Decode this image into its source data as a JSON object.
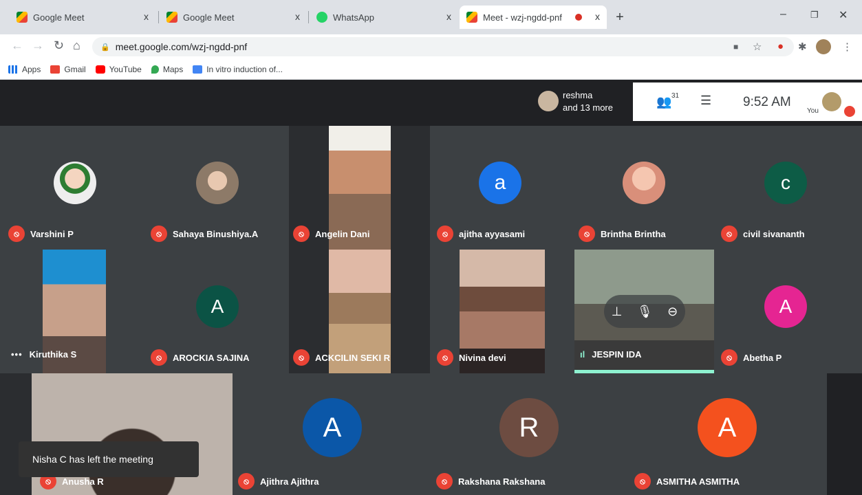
{
  "browser": {
    "tabs": [
      {
        "title": "Google Meet",
        "close": "x"
      },
      {
        "title": "Google Meet",
        "close": "x"
      },
      {
        "title": "WhatsApp",
        "close": "x"
      },
      {
        "title": "Meet - wzj-ngdd-pnf",
        "close": "x"
      }
    ],
    "new_tab": "+",
    "url": "meet.google.com/wzj-ngdd-pnf",
    "bookmarks": [
      "Apps",
      "Gmail",
      "YouTube",
      "Maps",
      "In vitro induction of..."
    ]
  },
  "meet": {
    "presenter": {
      "name": "reshma",
      "more": "and 13 more"
    },
    "participant_count": "31",
    "time": "9:52 AM",
    "self_label": "You",
    "toast": "Nisha C has left the meeting",
    "tiles": [
      {
        "name": "Varshini P",
        "kind": "photo",
        "muted": true
      },
      {
        "name": "Sahaya Binushiya.A",
        "kind": "photo",
        "muted": true
      },
      {
        "name": "Angelin Dani",
        "kind": "video",
        "muted": true
      },
      {
        "name": "ajitha ayyasami",
        "kind": "letter",
        "letter": "a",
        "color": "#1a73e8",
        "muted": true
      },
      {
        "name": "Brintha Brintha",
        "kind": "photo",
        "muted": true
      },
      {
        "name": "civil sivananth",
        "kind": "letter",
        "letter": "c",
        "color": "#0d5c46",
        "muted": true
      },
      {
        "name": "Kiruthika S",
        "kind": "video",
        "muted": false,
        "indicator": "•••"
      },
      {
        "name": "AROCKIA SAJINA",
        "kind": "letter",
        "letter": "A",
        "color": "#0b5345",
        "muted": true
      },
      {
        "name": "ACKCILIN SEKI R",
        "kind": "video",
        "muted": true
      },
      {
        "name": "Nivina devi",
        "kind": "video",
        "muted": true
      },
      {
        "name": "JESPIN IDA",
        "kind": "video",
        "muted": false,
        "indicator": "speaking"
      },
      {
        "name": "Abetha P",
        "kind": "letter",
        "letter": "A",
        "color": "#e52592",
        "muted": true
      },
      {
        "name": "Anusha R",
        "kind": "video",
        "muted": true
      },
      {
        "name": "Ajithra Ajithra",
        "kind": "letter",
        "letter": "A",
        "color": "#0b57a8",
        "muted": true
      },
      {
        "name": "Rakshana Rakshana",
        "kind": "letter",
        "letter": "R",
        "color": "#6d4c41",
        "muted": true
      },
      {
        "name": "ASMITHA ASMITHA",
        "kind": "letter",
        "letter": "A",
        "color": "#f4511e",
        "muted": true
      }
    ]
  }
}
